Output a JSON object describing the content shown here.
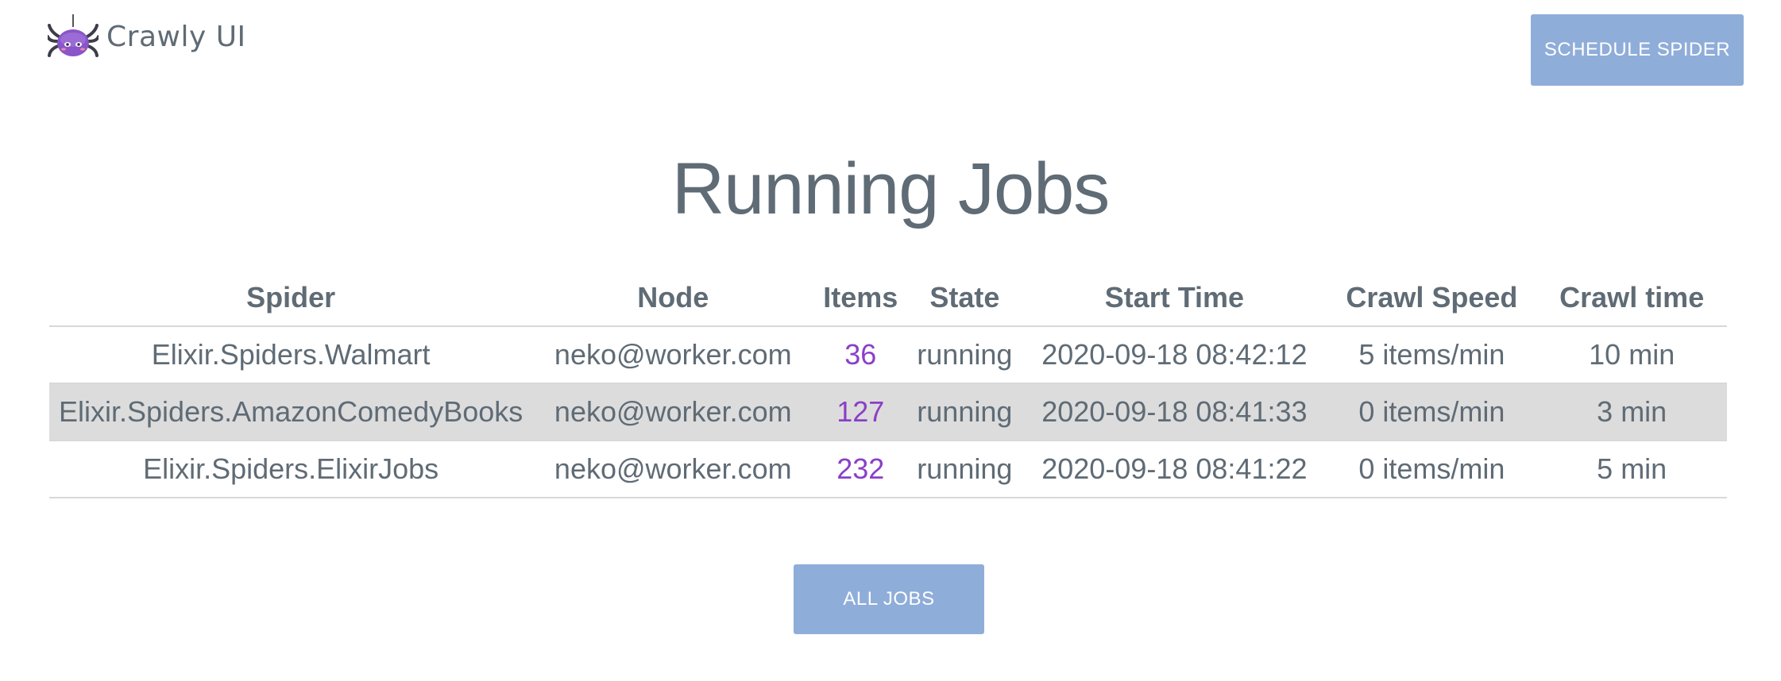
{
  "app": {
    "name": "Crawly UI",
    "logo_icon": "spider-logo-icon"
  },
  "header": {
    "schedule_label": "SCHEDULE SPIDER"
  },
  "main": {
    "title": "Running Jobs",
    "table": {
      "columns": [
        "Spider",
        "Node",
        "Items",
        "State",
        "Start Time",
        "Crawl Speed",
        "Crawl time"
      ],
      "rows": [
        {
          "spider": "Elixir.Spiders.Walmart",
          "node": "neko@worker.com",
          "items": "36",
          "state": "running",
          "start_time": "2020-09-18 08:42:12",
          "crawl_speed": "5 items/min",
          "crawl_time": "10 min"
        },
        {
          "spider": "Elixir.Spiders.AmazonComedyBooks",
          "node": "neko@worker.com",
          "items": "127",
          "state": "running",
          "start_time": "2020-09-18 08:41:33",
          "crawl_speed": "0 items/min",
          "crawl_time": "3 min"
        },
        {
          "spider": "Elixir.Spiders.ElixirJobs",
          "node": "neko@worker.com",
          "items": "232",
          "state": "running",
          "start_time": "2020-09-18 08:41:22",
          "crawl_speed": "0 items/min",
          "crawl_time": "5 min"
        }
      ]
    },
    "all_jobs_label": "ALL JOBS"
  },
  "colors": {
    "accent_button": "#8fadd9",
    "items_link": "#8b3fc7",
    "text": "#5f6b75",
    "row_highlight": "#dcdcdc"
  }
}
